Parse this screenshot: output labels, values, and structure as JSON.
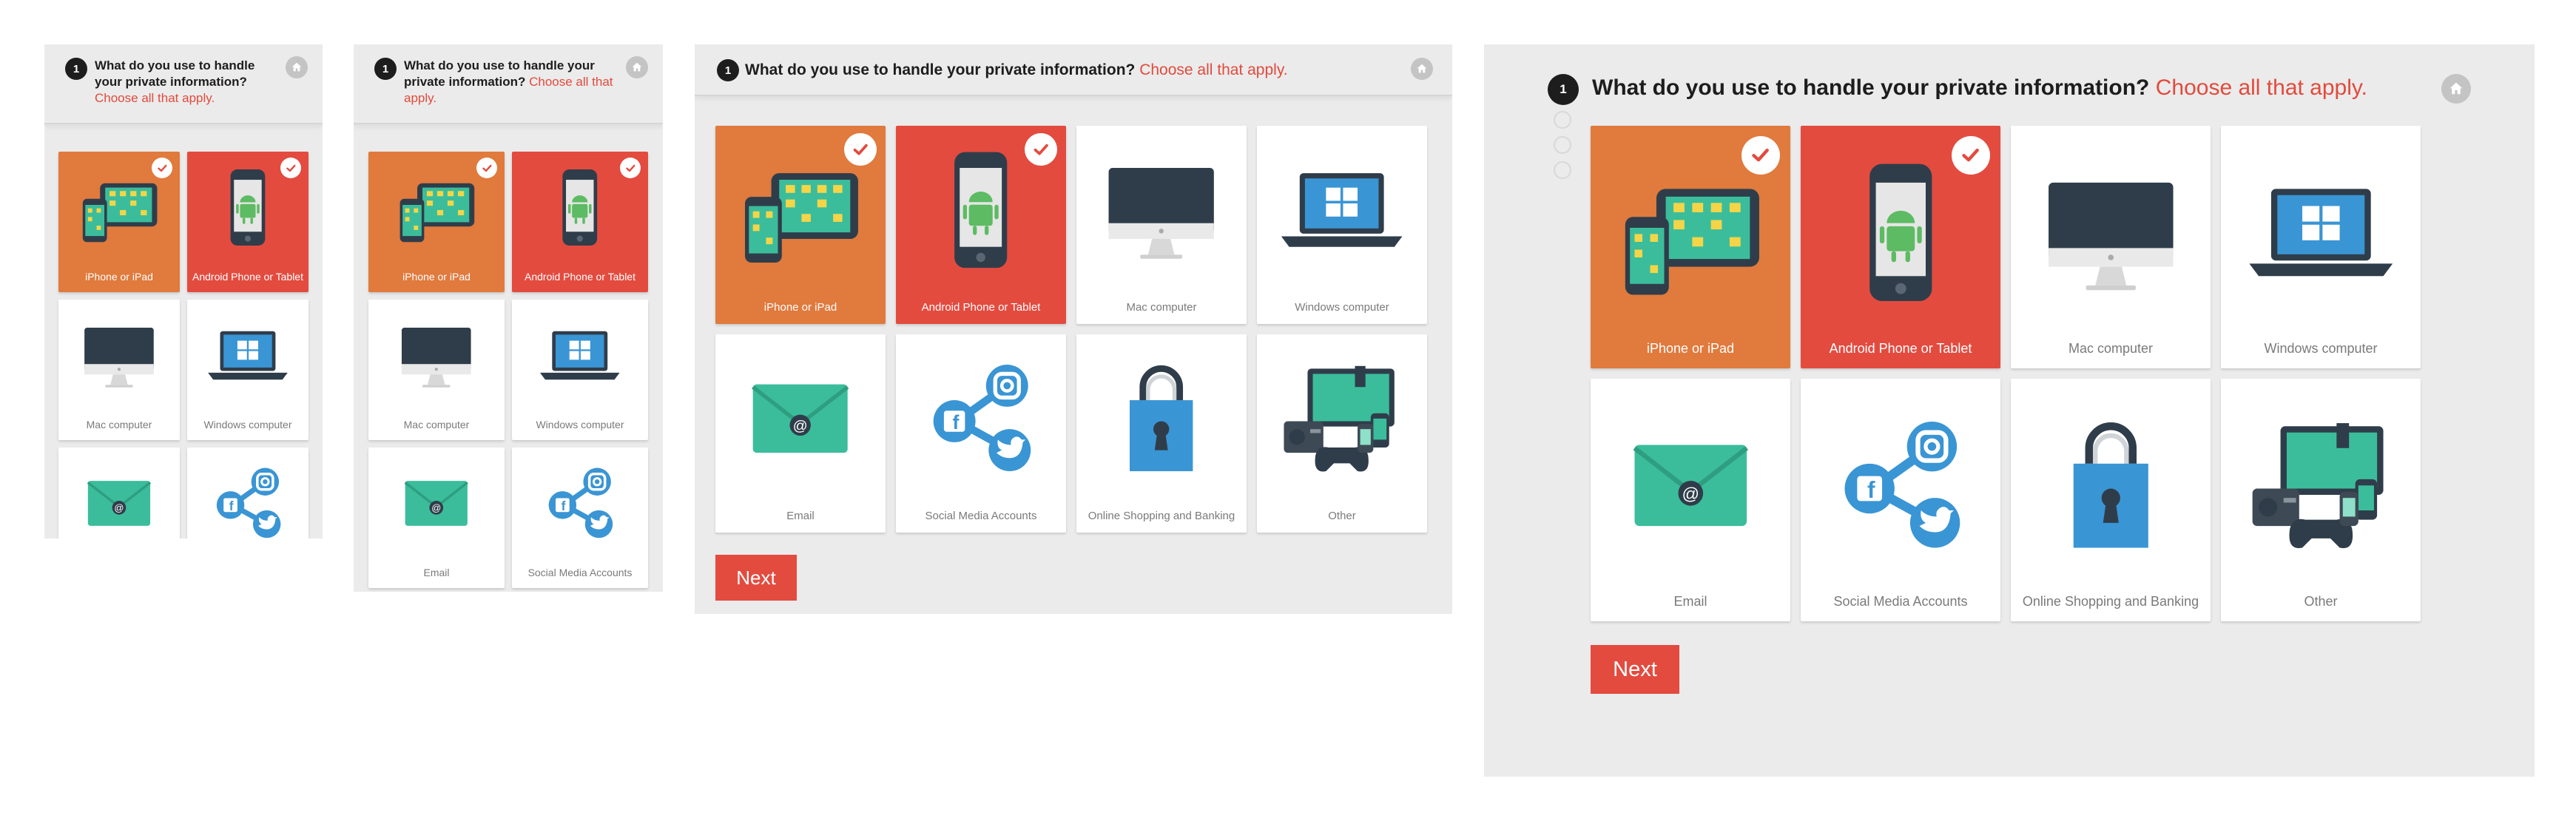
{
  "question": {
    "number": "1",
    "text": "What do you use to handle your private information?",
    "highlight": "Choose all that apply."
  },
  "options": [
    {
      "label": "iPhone or iPad",
      "icon": "apple-devices-icon",
      "selected": true
    },
    {
      "label": "Android Phone or Tablet",
      "icon": "android-phone-icon",
      "selected": true
    },
    {
      "label": "Mac computer",
      "icon": "mac-computer-icon",
      "selected": false
    },
    {
      "label": "Windows computer",
      "icon": "windows-laptop-icon",
      "selected": false
    },
    {
      "label": "Email",
      "icon": "email-envelope-icon",
      "selected": false
    },
    {
      "label": "Social Media Accounts",
      "icon": "social-media-icon",
      "selected": false
    },
    {
      "label": "Online Shopping and Banking",
      "icon": "shopping-bag-lock-icon",
      "selected": false
    },
    {
      "label": "Other",
      "icon": "other-devices-icon",
      "selected": false
    }
  ],
  "next_label": "Next",
  "colors": {
    "accent": "#e34b3f",
    "orange": "#e07a3d",
    "panel": "#ebebeb",
    "teal": "#3bbd9b",
    "blue": "#3a95d4",
    "dark": "#2f3d4a"
  }
}
